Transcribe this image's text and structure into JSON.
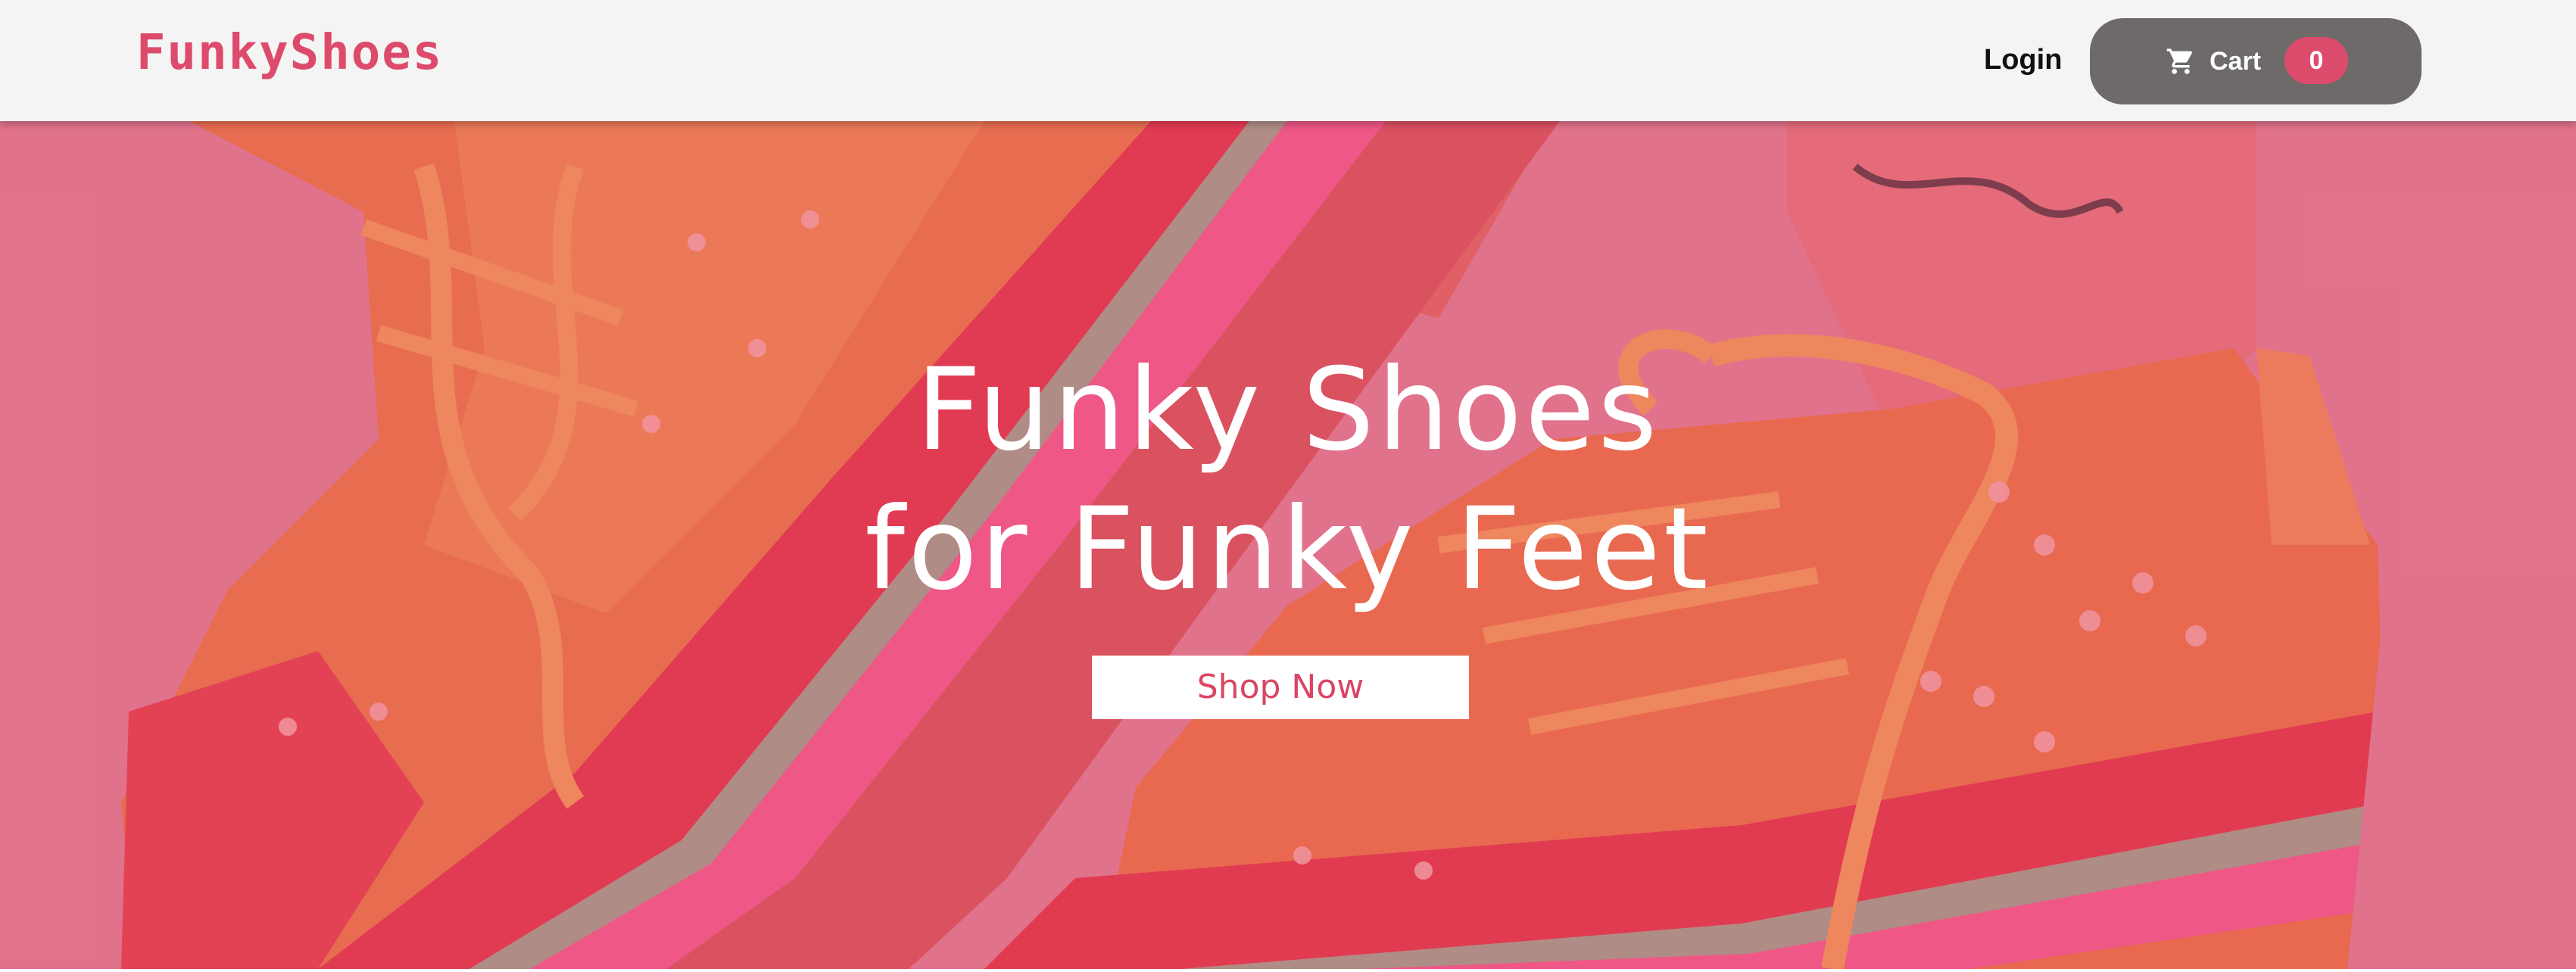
{
  "navbar": {
    "logo_text": "FunkyShoes",
    "login_label": "Login",
    "cart": {
      "label": "Cart",
      "count": "0",
      "icon": "shopping-cart-icon"
    }
  },
  "hero": {
    "title_line1": "Funky Shoes",
    "title_line2": "for Funky Feet",
    "cta_label": "Shop Now",
    "background": "photo of orange patent-leather platform sneakers with pink tint overlay"
  },
  "colors": {
    "brand_pink": "#dd4b6c",
    "nav_bg": "#f4f4f4",
    "cart_button_bg": "#6d6a69",
    "hero_tint": "#e27b90",
    "shoe_orange": "#e9704a",
    "sole_red": "#e0374a"
  }
}
